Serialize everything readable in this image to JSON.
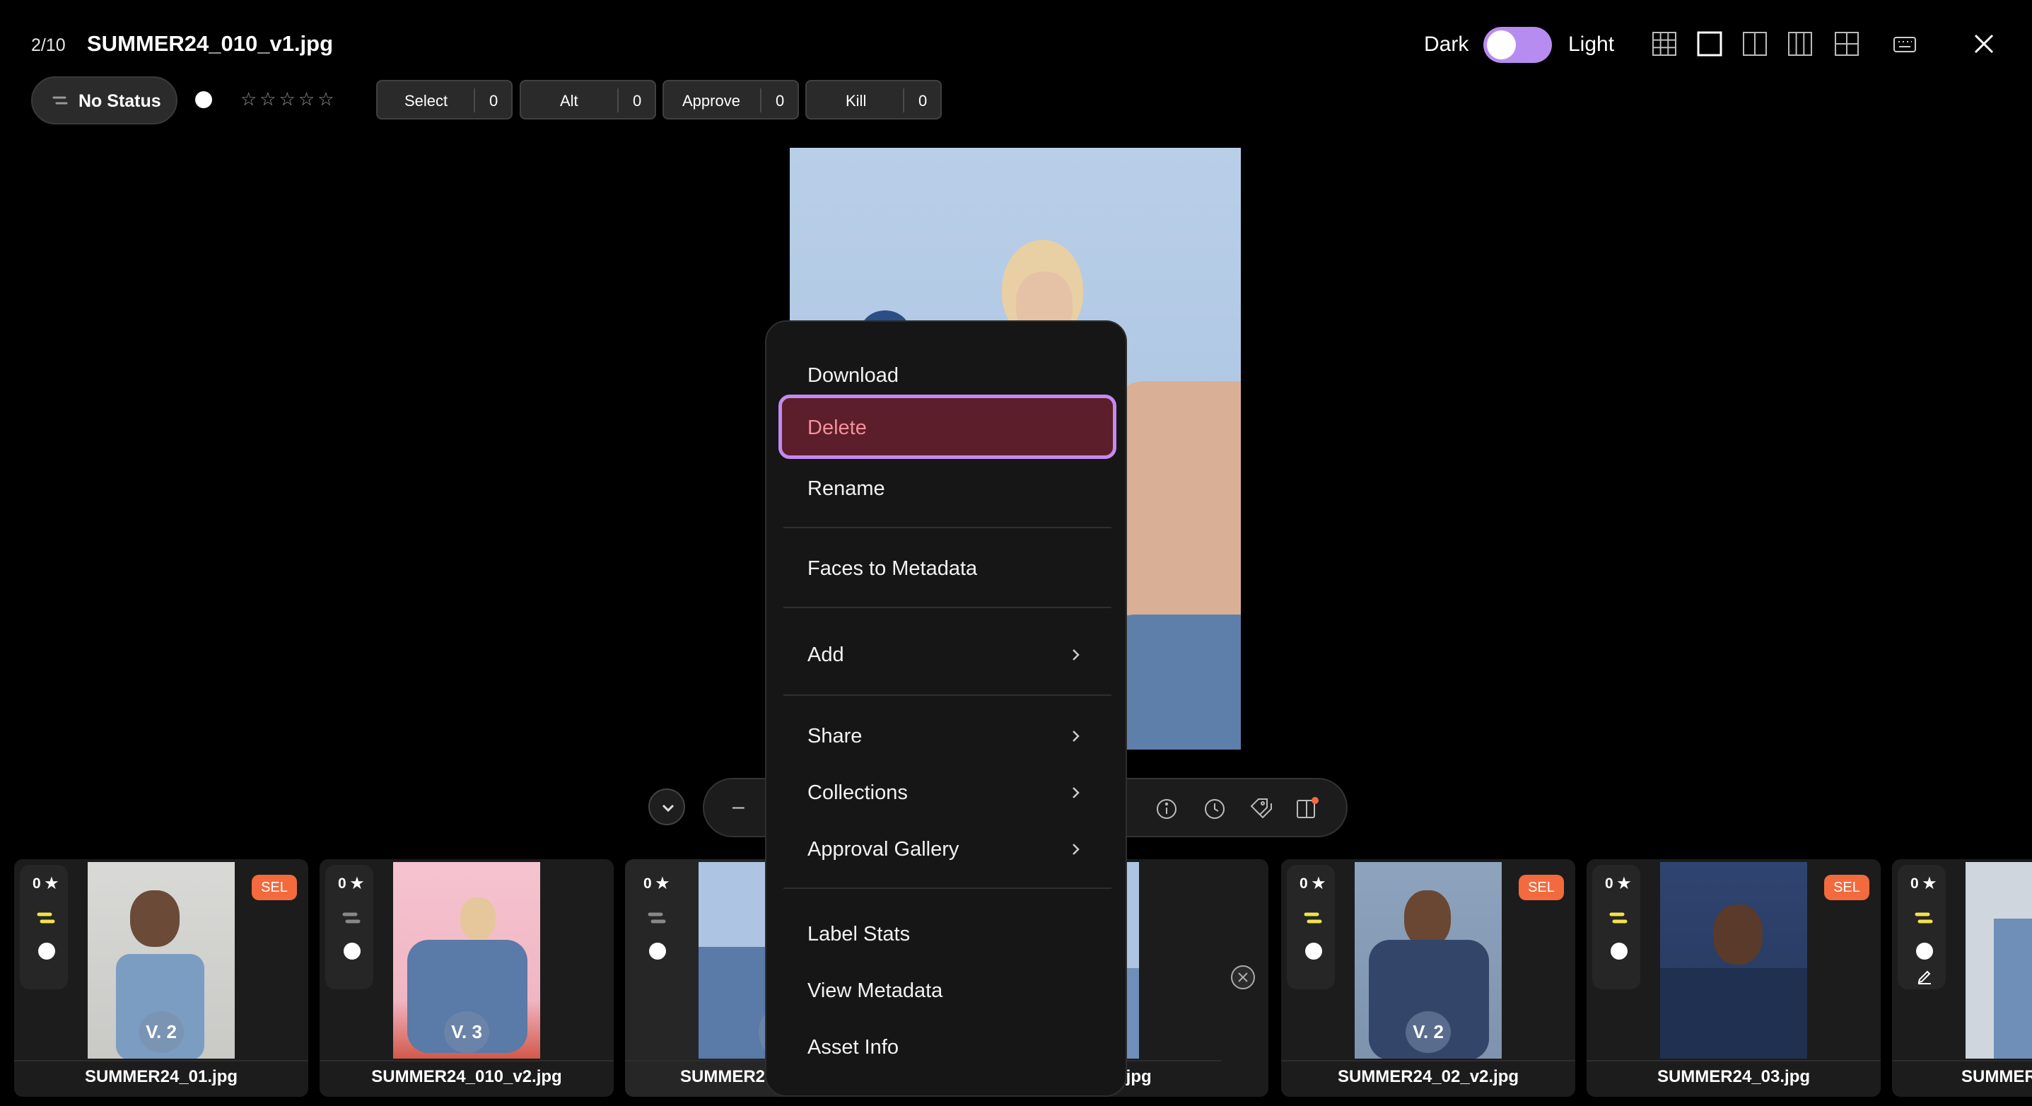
{
  "header": {
    "counter": "2/10",
    "filename": "SUMMER24_010_v1.jpg",
    "theme_dark_label": "Dark",
    "theme_light_label": "Light"
  },
  "toolbar": {
    "status_label": "No Status",
    "stars": "☆☆☆☆☆",
    "counters": [
      {
        "label": "Select",
        "count": "0"
      },
      {
        "label": "Alt",
        "count": "0"
      },
      {
        "label": "Approve",
        "count": "0"
      },
      {
        "label": "Kill",
        "count": "0"
      }
    ]
  },
  "zoom": {
    "minus": "–"
  },
  "menu": {
    "items": {
      "download": "Download",
      "delete": "Delete",
      "rename": "Rename",
      "faces_to_metadata": "Faces to Metadata",
      "add": "Add",
      "share": "Share",
      "collections": "Collections",
      "approval_gallery": "Approval Gallery",
      "label_stats": "Label Stats",
      "view_metadata": "View Metadata",
      "asset_info": "Asset Info"
    }
  },
  "filmstrip": [
    {
      "rating": "0 ★",
      "badge": "SEL",
      "version": "V. 2",
      "name": "SUMMER24_01.jpg",
      "flag_color": "#f2e34a"
    },
    {
      "rating": "0 ★",
      "badge": "",
      "version": "V. 3",
      "name": "SUMMER24_010_v2.jpg",
      "flag_color": "#888888"
    },
    {
      "rating": "0 ★",
      "badge": "",
      "version": "V",
      "name": "SUMMER24",
      "flag_color": "#888888"
    },
    {
      "rating": "",
      "badge": "",
      "version": "",
      "name": ".jpg",
      "flag_color": ""
    },
    {
      "rating": "0 ★",
      "badge": "SEL",
      "version": "V. 2",
      "name": "SUMMER24_02_v2.jpg",
      "flag_color": "#f2e34a"
    },
    {
      "rating": "0 ★",
      "badge": "SEL",
      "version": "",
      "name": "SUMMER24_03.jpg",
      "flag_color": "#f2e34a"
    },
    {
      "rating": "0 ★",
      "badge": "",
      "version": "",
      "name": "SUMMER",
      "flag_color": "#f2e34a"
    }
  ],
  "colors": {
    "accent": "#b78cf0",
    "sel_badge": "#f26a3d",
    "delete_bg": "#5c1e2a",
    "delete_text": "#f3909c"
  }
}
